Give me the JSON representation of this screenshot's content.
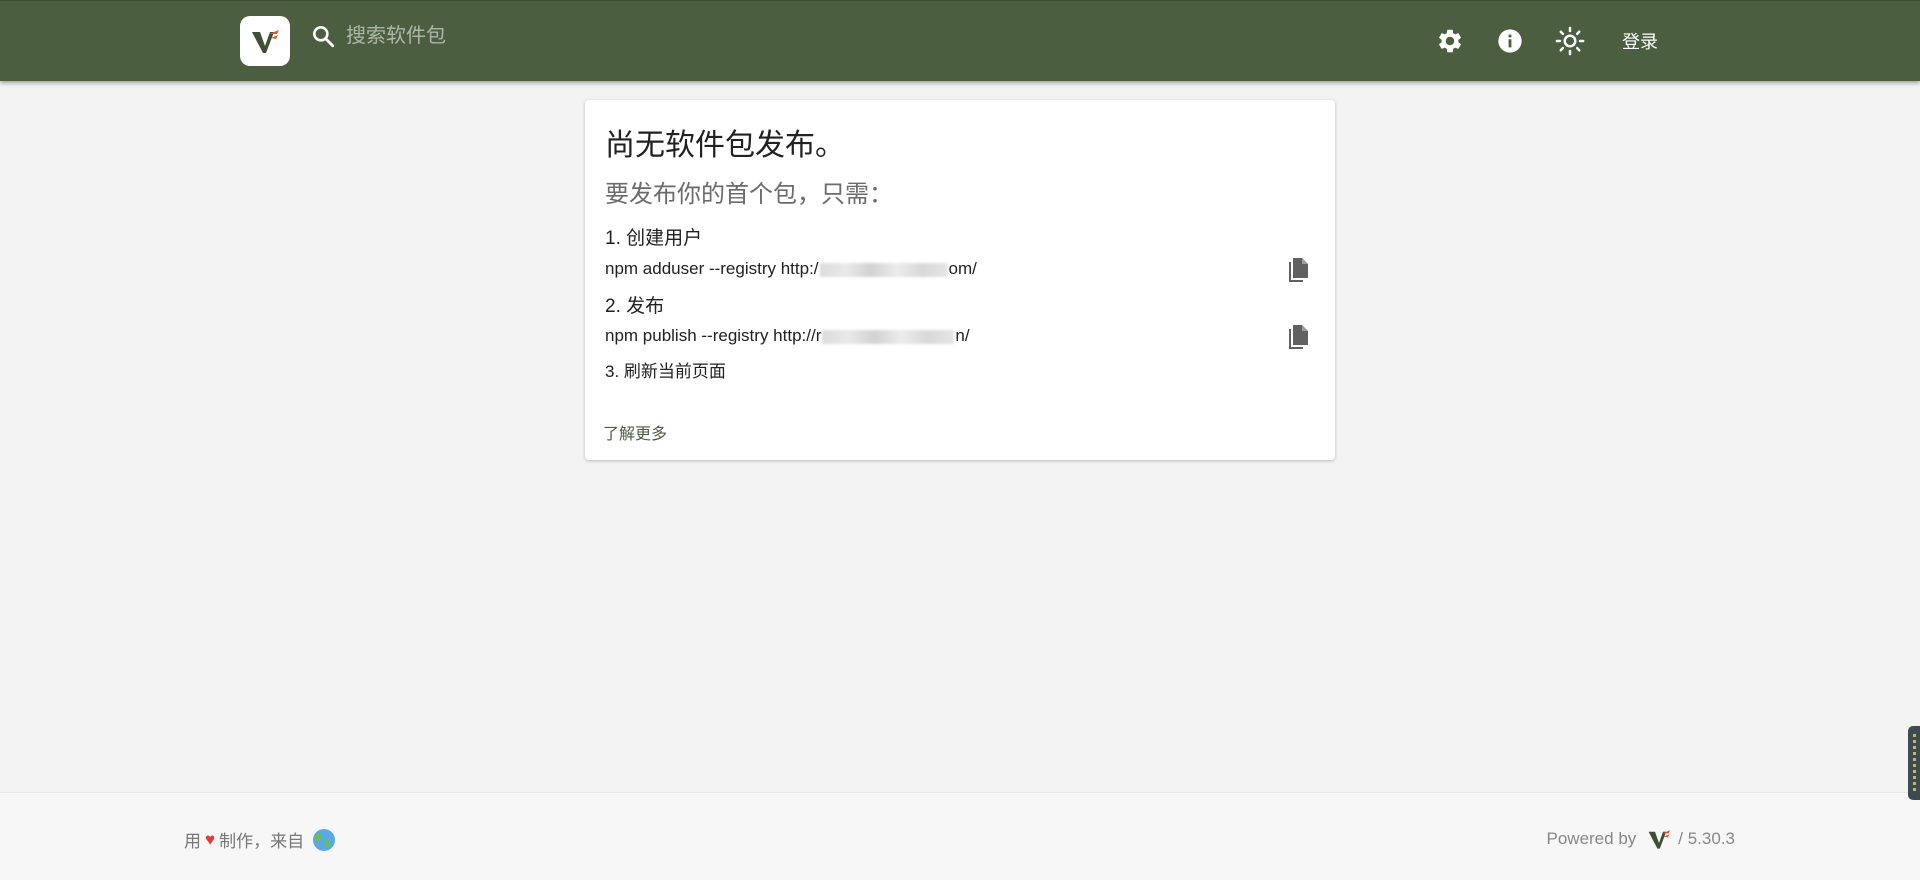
{
  "header": {
    "search_placeholder": "搜索软件包",
    "login_label": "登录",
    "icons": [
      "settings-icon",
      "info-icon",
      "theme-brightness-icon"
    ]
  },
  "card": {
    "title": "尚无软件包发布。",
    "subtitle": "要发布你的首个包，只需：",
    "step1_label": "1. 创建用户",
    "step1_cmd_prefix": "npm adduser --registry http:/",
    "step1_cmd_suffix": "om/",
    "step2_label": "2. 发布",
    "step2_cmd_prefix": "npm publish --registry http://r",
    "step2_cmd_suffix": "n/",
    "step3_label": "3. 刷新当前页面",
    "learn_more": "了解更多"
  },
  "footer": {
    "made_with_prefix": "用",
    "heart": "♥",
    "made_with_suffix": "制作，来自",
    "powered_by": "Powered by",
    "version": "/ 5.30.3"
  },
  "colors": {
    "header_bg": "#4b5e40",
    "page_bg": "#f3f3f3",
    "accent": "#4b5e40",
    "logo_orange": "#e8542a"
  }
}
